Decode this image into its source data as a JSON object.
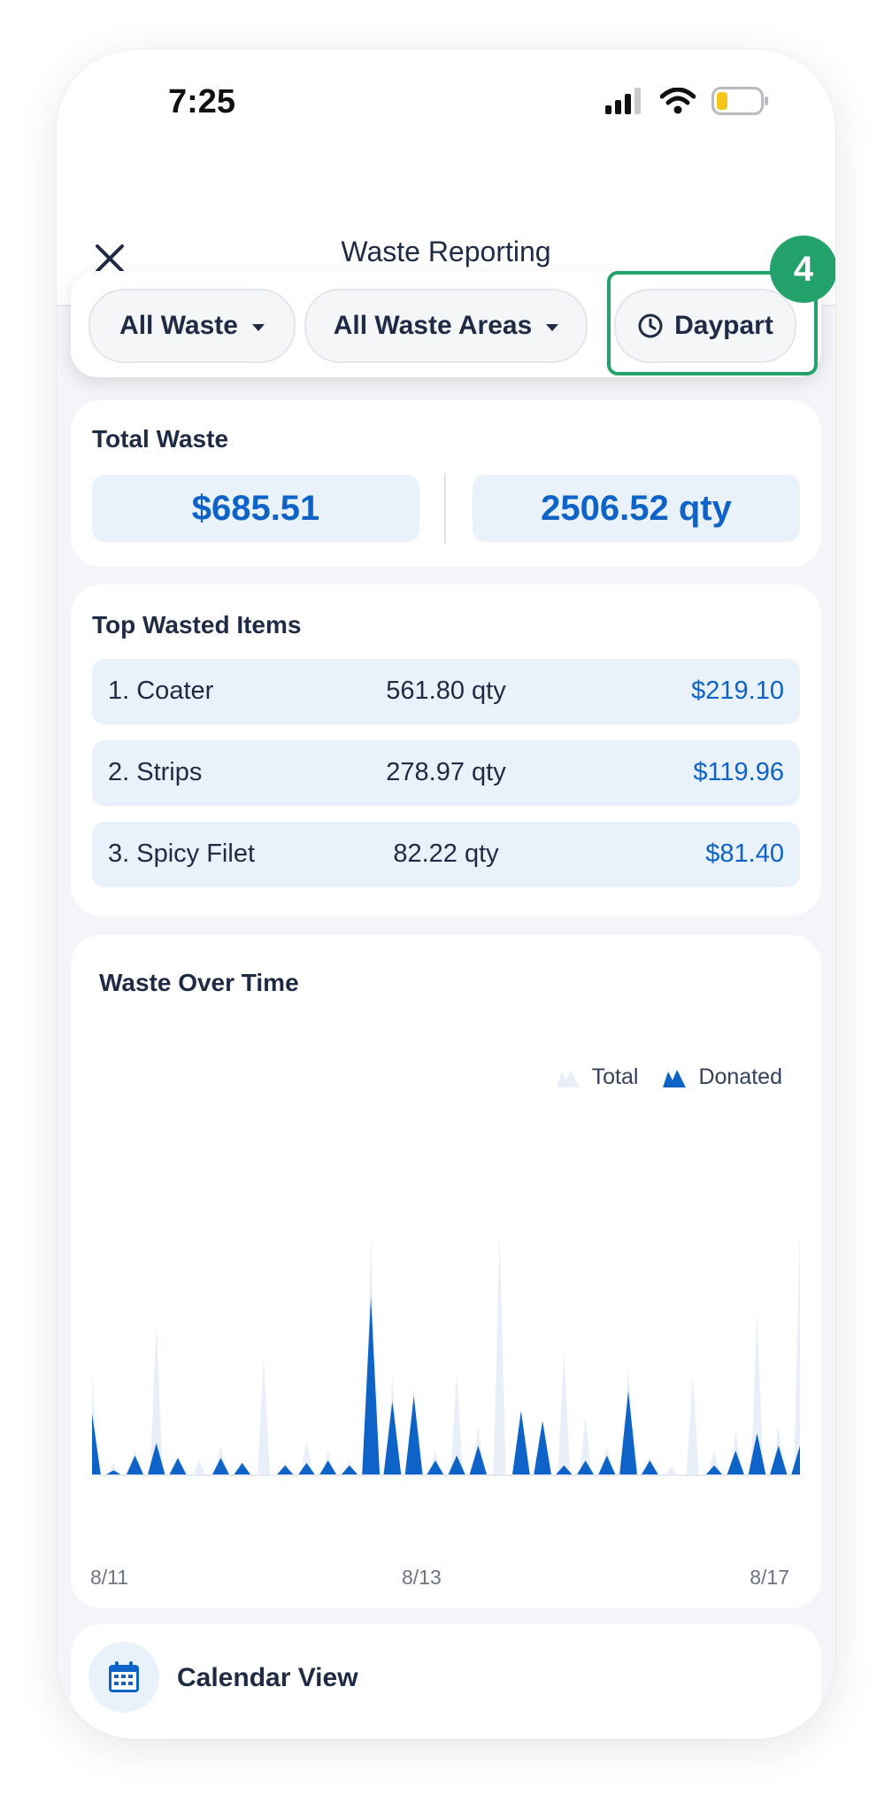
{
  "status_bar": {
    "time": "7:25"
  },
  "header": {
    "title": "Waste Reporting"
  },
  "filters": {
    "waste_type": "All Waste",
    "waste_area": "All Waste Areas",
    "daypart": "Daypart",
    "step_badge": "4"
  },
  "total_waste": {
    "title": "Total Waste",
    "cost": "$685.51",
    "quantity": "2506.52 qty"
  },
  "top_wasted_items": {
    "title": "Top Wasted Items",
    "items": [
      {
        "name": "1. Coater",
        "qty": "561.80 qty",
        "cost": "$219.10"
      },
      {
        "name": "2. Strips",
        "qty": "278.97 qty",
        "cost": "$119.96"
      },
      {
        "name": "3. Spicy Filet",
        "qty": "82.22 qty",
        "cost": "$81.40"
      }
    ]
  },
  "chart_data": {
    "type": "area",
    "title": "Waste Over Time",
    "xlabel": "",
    "ylabel": "",
    "x_ticks": [
      "8/11",
      "8/13",
      "8/17"
    ],
    "legend": {
      "placement": "top-right",
      "entries": [
        "Total",
        "Donated"
      ]
    },
    "colors": {
      "Total": "#e8eff8",
      "Donated": "#0d63c8"
    },
    "series": [
      {
        "name": "Total",
        "values": [
          0.42,
          0.05,
          0.1,
          0.62,
          0.08,
          0.06,
          0.12,
          0.06,
          0.48,
          0.05,
          0.14,
          0.1,
          0.06,
          0.96,
          0.4,
          0.36,
          0.1,
          0.42,
          0.2,
          0.98,
          0.14,
          0.18,
          0.5,
          0.24,
          0.12,
          0.44,
          0.08,
          0.04,
          0.4,
          0.1,
          0.18,
          0.66,
          0.2,
          1.0
        ]
      },
      {
        "name": "Donated",
        "values": [
          0.25,
          0.02,
          0.08,
          0.13,
          0.07,
          0.0,
          0.07,
          0.05,
          0.0,
          0.04,
          0.05,
          0.06,
          0.04,
          0.72,
          0.3,
          0.32,
          0.06,
          0.08,
          0.12,
          0.0,
          0.26,
          0.22,
          0.04,
          0.06,
          0.08,
          0.34,
          0.06,
          0.0,
          0.0,
          0.04,
          0.1,
          0.17,
          0.12,
          0.12
        ]
      }
    ]
  },
  "calendar": {
    "label": "Calendar View"
  }
}
